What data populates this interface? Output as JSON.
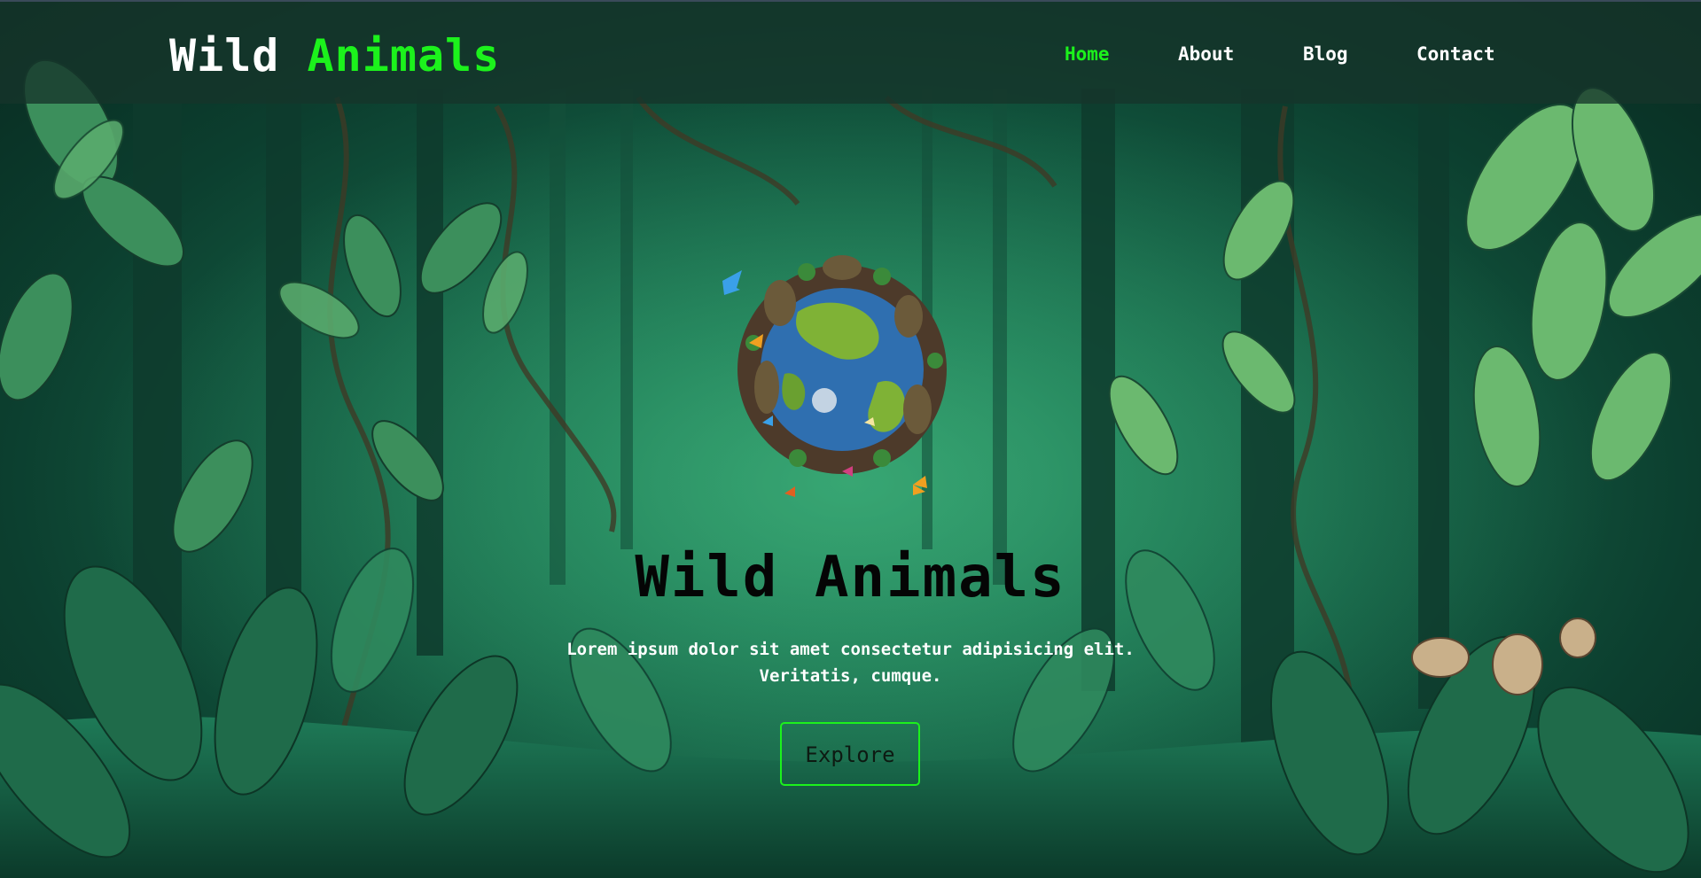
{
  "header": {
    "logo_word1": "Wild",
    "logo_word2": "Animals",
    "nav": [
      {
        "label": "Home",
        "active": true
      },
      {
        "label": "About",
        "active": false
      },
      {
        "label": "Blog",
        "active": false
      },
      {
        "label": "Contact",
        "active": false
      }
    ]
  },
  "hero": {
    "title": "Wild Animals",
    "text_line1": "Lorem ipsum dolor sit amet consectetur adipisicing elit.",
    "text_line2": "Veritatis, cumque.",
    "button_label": "Explore",
    "image": "animal-globe-illustration"
  },
  "colors": {
    "accent": "#1cf21c",
    "header_bg": "#16342a",
    "jungle_dark": "#082a20",
    "jungle_mid": "#1d7a55"
  }
}
